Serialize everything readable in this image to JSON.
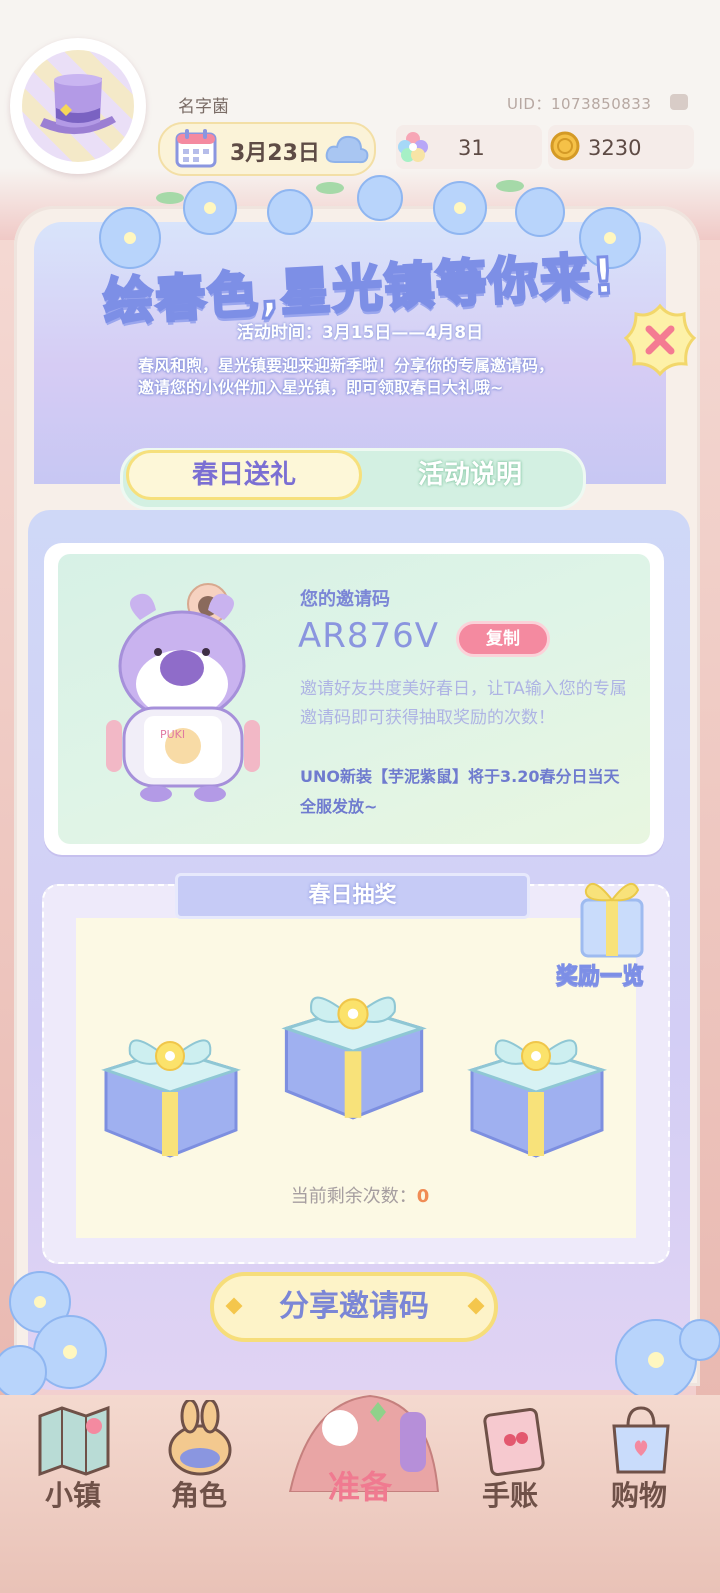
{
  "header": {
    "nickname": "名字菌",
    "uid": "UID：1073850833",
    "date": "3月23日",
    "gems": "31",
    "coins": "3230"
  },
  "event": {
    "title": "绘春色,星光镇等你来!",
    "time": "活动时间：3月15日——4月8日",
    "description": "春风和煦，星光镇要迎来迎新季啦！分享你的专属邀请码，邀请您的小伙伴加入星光镇，即可领取春日大礼哦~"
  },
  "tabs": {
    "active": "春日送礼",
    "inactive": "活动说明"
  },
  "invite": {
    "label": "您的邀请码",
    "code": "AR876V",
    "copy_label": "复制",
    "description": "邀请好友共度美好春日，让TA输入您的专属邀请码即可获得抽取奖励的次数！",
    "promo": "UNO新装【芋泥紫鼠】将于3.20春分日当天全服发放~",
    "mascot_bib_text": "PUKI"
  },
  "lottery": {
    "title": "春日抽奖",
    "reward_list_label": "奖励一览",
    "remaining_label": "当前剩余次数：",
    "remaining_count": "0"
  },
  "share_button": "分享邀请码",
  "nav": {
    "items": [
      "小镇",
      "角色",
      "准备",
      "手账",
      "购物"
    ],
    "active_index": 2
  },
  "colors": {
    "accent_blue": "#7b86d6",
    "accent_pink": "#f48aa0",
    "accent_yellow": "#f6dd7a",
    "tab_green": "#d3f0e2"
  }
}
